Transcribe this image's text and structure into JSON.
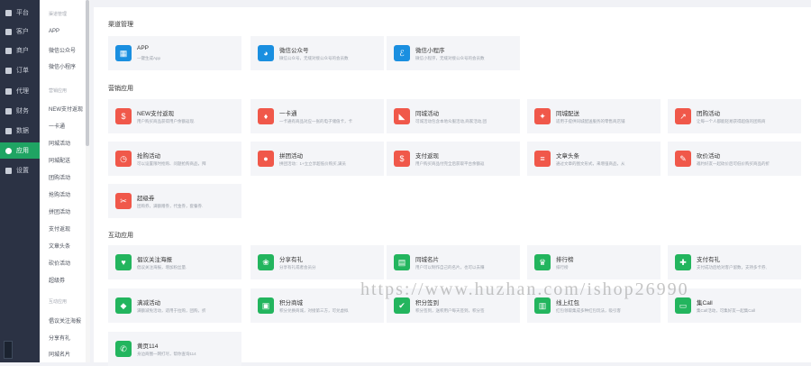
{
  "nav": [
    {
      "label": "平台",
      "icon": "monitor-icon"
    },
    {
      "label": "客户",
      "icon": "user-icon"
    },
    {
      "label": "商户",
      "icon": "users-icon"
    },
    {
      "label": "订单",
      "icon": "list-icon"
    },
    {
      "label": "代理",
      "icon": "building-icon"
    },
    {
      "label": "财务",
      "icon": "wallet-icon"
    },
    {
      "label": "数据",
      "icon": "chart-icon"
    },
    {
      "label": "应用",
      "icon": "app-icon",
      "active": true
    },
    {
      "label": "设置",
      "icon": "gear-icon"
    }
  ],
  "sidebar": {
    "heading1": "渠道管理",
    "items1": [
      "APP",
      "微信公众号",
      "微信小程序"
    ],
    "heading2": "营销应用",
    "items2": [
      "NEW支付返现",
      "一卡通",
      "同城活动",
      "同城配送",
      "团购活动",
      "抢购活动",
      "拼团活动",
      "支付返现",
      "文章头条",
      "砍价活动",
      "超级券"
    ],
    "heading3": "互动应用",
    "items3": [
      "倡议关注海报",
      "分享有礼",
      "同城名片"
    ]
  },
  "sections": {
    "channel": "渠道管理",
    "marketing": "营销应用",
    "interactive": "互动应用"
  },
  "channel_cards": [
    {
      "title": "APP",
      "desc": "一键生成App",
      "icon": "grid-icon",
      "glyph": "▦"
    },
    {
      "title": "微信公众号",
      "desc": "微信公众号，无缝对接公众号的会员数",
      "icon": "wechat-icon",
      "glyph": "◕"
    },
    {
      "title": "微信小程序",
      "desc": "微信小程序，无缝对接公众号的会员数",
      "icon": "mini-program-icon",
      "glyph": "ℰ"
    }
  ],
  "marketing_cards": [
    {
      "title": "NEW支付返现",
      "desc": "用户购买商品获得用户余额返现.",
      "icon": "money-bag-icon",
      "glyph": "$"
    },
    {
      "title": "一卡通",
      "desc": "一卡通有商品对应一张的电子储值卡，卡",
      "icon": "diamond-icon",
      "glyph": "♦"
    },
    {
      "title": "同城活动",
      "desc": "可城活动包含本地众服活动,商家活动,团",
      "icon": "megaphone-icon",
      "glyph": "◣"
    },
    {
      "title": "同城配送",
      "desc": "适用于提供同城配送服务的零售商店铺",
      "icon": "scooter-icon",
      "glyph": "✦"
    },
    {
      "title": "团购活动",
      "desc": "让每一个人都能轻易获得超值的团购商",
      "icon": "share-icon",
      "glyph": "↗"
    },
    {
      "title": "抢购活动",
      "desc": "可以设置限时抢购、问题抢购商品，拜",
      "icon": "timer-icon",
      "glyph": "◷"
    },
    {
      "title": "拼团活动",
      "desc": "拼团活动：1+立立享超低价购买,满员",
      "icon": "people-icon",
      "glyph": "●"
    },
    {
      "title": "支付返现",
      "desc": "用户购买商品付完全后获取平台余额返",
      "icon": "cash-bag-icon",
      "glyph": "$"
    },
    {
      "title": "文章头条",
      "desc": "通过文章的图文形式，来增强商品，从",
      "icon": "article-icon",
      "glyph": "≡"
    },
    {
      "title": "砍价活动",
      "desc": "邀约好友一起砍价后可低价购买商品的折",
      "icon": "pen-icon",
      "glyph": "✎"
    },
    {
      "title": "超级券",
      "desc": "团购券，满额赠券，代金券，套餐券.",
      "icon": "coupon-icon",
      "glyph": "✂"
    }
  ],
  "interactive_cards": [
    {
      "title": "倡议关注海报",
      "desc": "倡议关注海报，增加粉丝量.",
      "icon": "heart-icon",
      "glyph": "♥",
      "color": "#23b55e"
    },
    {
      "title": "分享有礼",
      "desc": "分享有礼或者会员分",
      "icon": "share-gift-icon",
      "glyph": "❀",
      "color": "#23b55e"
    },
    {
      "title": "同城名片",
      "desc": "用户可以制作自己的名片，也可以去赚",
      "icon": "card-icon",
      "glyph": "▤",
      "color": "#23b55e"
    },
    {
      "title": "排行榜",
      "desc": "排行榜",
      "icon": "trophy-icon",
      "glyph": "♛",
      "color": "#23b55e"
    },
    {
      "title": "支付有礼",
      "desc": "支付成功后给对客户留数，支持多卡券,",
      "icon": "gift-icon",
      "glyph": "✚",
      "color": "#23b55e"
    },
    {
      "title": "满减活动",
      "desc": "满额减免活动，适用于拉购，团购，折",
      "icon": "tag-icon",
      "glyph": "◆",
      "color": "#23b55e"
    },
    {
      "title": "积分商城",
      "desc": "积分兑换商城，对接第三方，可兑虚拟",
      "icon": "shop-icon",
      "glyph": "▣",
      "color": "#23b55e"
    },
    {
      "title": "积分签到",
      "desc": "积分签到，送积用户每天签到，积分签",
      "icon": "checkin-icon",
      "glyph": "✔",
      "color": "#23b55e"
    },
    {
      "title": "线上红包",
      "desc": "红包领取集成多种红包玩法，吸引客",
      "icon": "red-packet-icon",
      "glyph": "▥",
      "color": "#23b55e"
    },
    {
      "title": "集Call",
      "desc": "集Call活动，可集好友一起集Call",
      "icon": "chat-icon",
      "glyph": "▭",
      "color": "#23b55e"
    },
    {
      "title": "黄页114",
      "desc": "身边商圈一网打尽，帮你查询114",
      "icon": "phonebook-icon",
      "glyph": "✆",
      "color": "#23b55e"
    }
  ],
  "watermark": "https://www.huzhan.com/ishop26990"
}
